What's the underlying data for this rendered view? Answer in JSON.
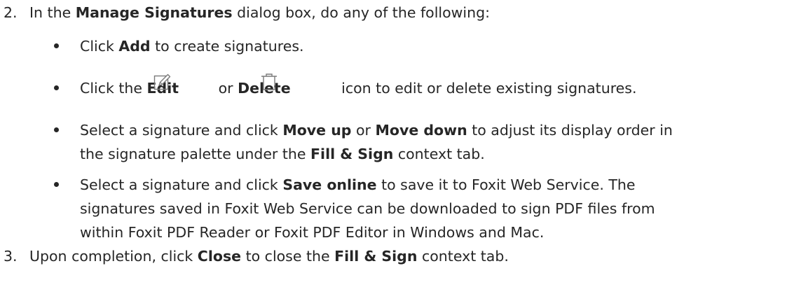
{
  "step2": {
    "number": "2.",
    "lead": "In the ",
    "dialog": "Manage Signatures",
    "tail": " dialog box, do any of the following:"
  },
  "bullets": [
    {
      "lines": [
        {
          "t1": "Click ",
          "b1": "Add",
          "t2": " to create signatures."
        }
      ]
    },
    {
      "t1": "Click the ",
      "b1": "Edit",
      "t2": " or ",
      "b2": "Delete",
      "t3": " icon to edit or delete existing signatures."
    },
    {
      "lines": [
        {
          "t1": "Select a signature and click ",
          "b1": "Move up",
          "t2": " or ",
          "b2": "Move down",
          "t3": " to adjust its display order in"
        },
        {
          "t1": "the signature palette under the ",
          "b1": "Fill & Sign",
          "t2": " context tab."
        }
      ]
    },
    {
      "lines": [
        {
          "t1": "Select a signature and click ",
          "b1": "Save online",
          "t2": " to save it to Foxit Web Service. The"
        },
        {
          "t1": "signatures saved in Foxit Web Service can be downloaded to sign PDF files from"
        },
        {
          "t1": "within Foxit PDF Reader or Foxit PDF Editor in Windows and Mac."
        }
      ]
    }
  ],
  "step3": {
    "number": "3.",
    "t1": "Upon completion, click ",
    "b1": "Close",
    "t2": " to close the ",
    "b2": "Fill & Sign",
    "t3": " context tab."
  },
  "icons": {
    "edit": "edit-icon",
    "delete": "delete-icon"
  }
}
